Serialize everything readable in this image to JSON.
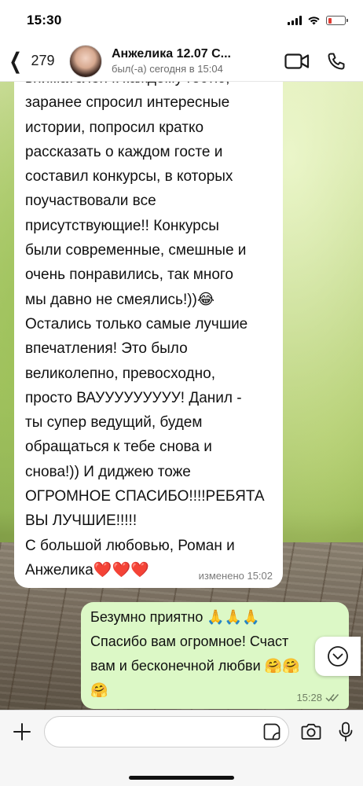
{
  "status_bar": {
    "time": "15:30",
    "signal_icon": "signal-bars-icon",
    "wifi_icon": "wifi-icon",
    "battery_icon": "battery-charging-icon",
    "battery_level": 0.12
  },
  "header": {
    "back_count": "279",
    "contact_name": "Анжелика 12.07 С...",
    "contact_status": "был(-а) сегодня в 15:04",
    "video_icon": "video-call-icon",
    "call_icon": "phone-call-icon"
  },
  "messages": {
    "incoming": {
      "text": "внимателен к каждому гостю,\nзаранее спросил интересные\nистории, попросил кратко\nрассказать о каждом госте и\nсоставил конкурсы, в которых\nпоучаствовали все\nприсутствующие!! Конкурсы\nбыли современные, смешные и\nочень понравились, так много\nмы давно не смеялись!))😂\nОстались только самые лучшие\nвпечатления! Это было\nвеликолепно, превосходно,\nпросто ВАУУУУУУУУУ! Данил -\nты супер ведущий, будем\nобращаться к тебе снова и\nснова!)) И диджею тоже\nОГРОМНОЕ СПАСИБО!!!!РЕБЯТА\nВЫ ЛУЧШИЕ!!!!!\nС большой любовью, Роман и\nАнжелика❤️❤️❤️",
      "meta": "изменено 15:02"
    },
    "outgoing": {
      "text": "Безумно приятно 🙏🙏🙏\nСпасибо вам огромное! Счаст\nвам и бесконечной любви 🤗🤗\n🤗",
      "time": "15:28",
      "read_icon": "double-check-icon"
    }
  },
  "input_bar": {
    "plus_icon": "plus-icon",
    "sticker_icon": "sticker-icon",
    "camera_icon": "camera-icon",
    "mic_icon": "microphone-icon",
    "placeholder": ""
  },
  "scroll_down_icon": "chevron-down-circle-icon"
}
